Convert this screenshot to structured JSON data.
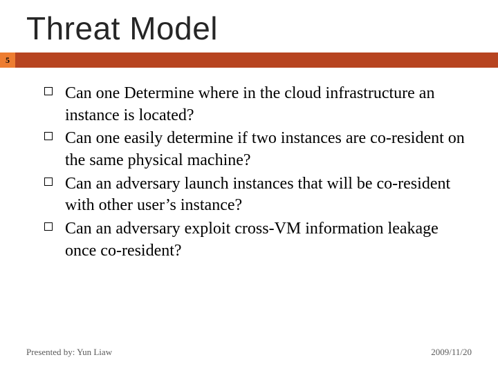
{
  "title": "Threat Model",
  "page_number": "5",
  "bullets": [
    "Can one Determine where in the cloud infrastructure an instance is located?",
    "Can one easily determine if two instances are co-resident on the same physical machine?",
    "Can an adversary launch instances that will be co-resident with other user’s instance?",
    "Can an adversary exploit cross-VM information leakage once co-resident?"
  ],
  "footer": {
    "presenter": "Presented by: Yun Liaw",
    "date": "2009/11/20"
  }
}
